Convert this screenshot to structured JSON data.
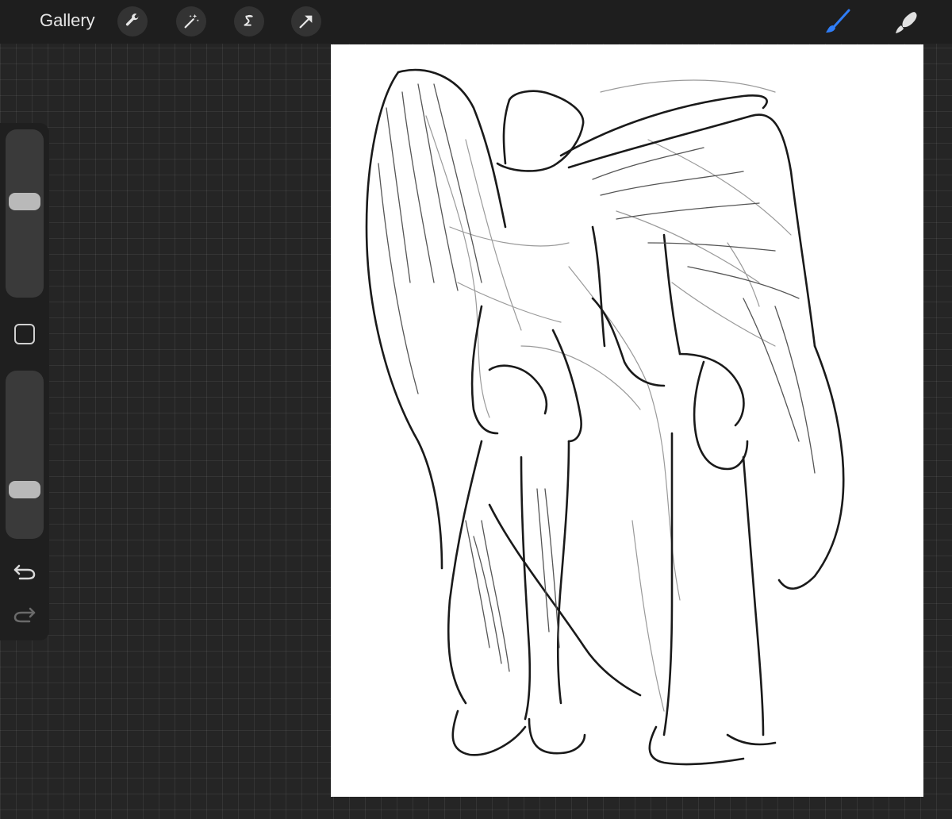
{
  "topbar": {
    "gallery_label": "Gallery",
    "tools": [
      {
        "name": "wrench-icon"
      },
      {
        "name": "magic-wand-icon"
      },
      {
        "name": "selection-icon"
      },
      {
        "name": "transform-arrow-icon"
      }
    ],
    "right_tools": [
      {
        "name": "brush-icon",
        "color": "#2f7df6",
        "active": true
      },
      {
        "name": "smudge-icon",
        "color": "#e0e0e0",
        "active": false
      }
    ]
  },
  "sidebar": {
    "brush_size_level": 0.58,
    "opacity_level": 0.26
  },
  "colors": {
    "background": "#252525",
    "toolbar": "#1e1e1e",
    "accent": "#2f7df6",
    "canvas": "#ffffff"
  }
}
